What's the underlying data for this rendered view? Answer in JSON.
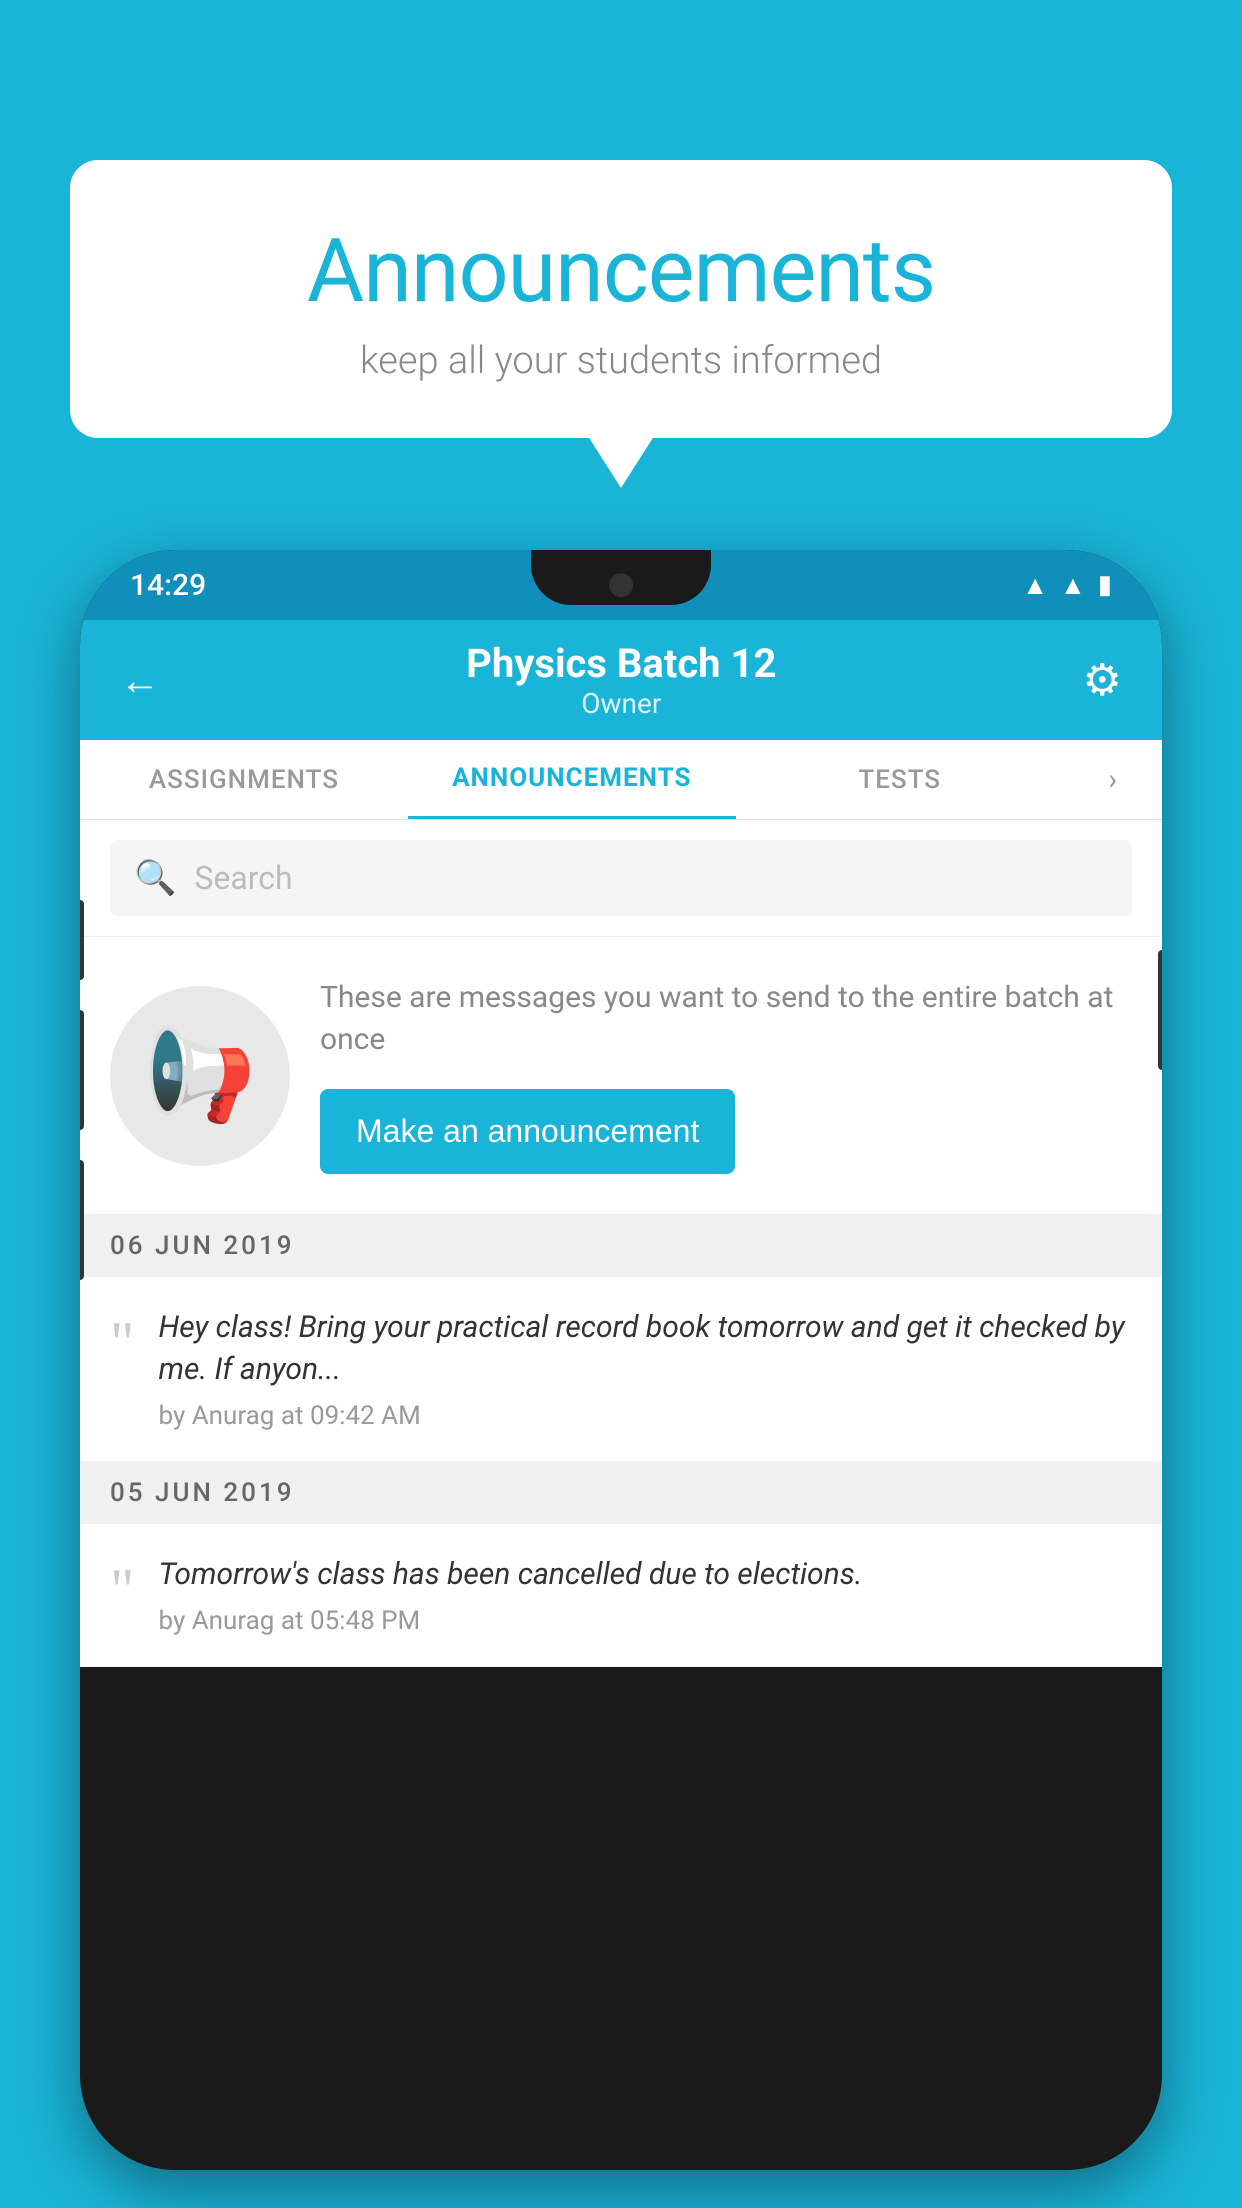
{
  "bubble": {
    "title": "Announcements",
    "subtitle": "keep all your students informed"
  },
  "status_bar": {
    "time": "14:29",
    "wifi": "▲",
    "signal": "▲",
    "battery": "▮"
  },
  "header": {
    "back_label": "←",
    "title": "Physics Batch 12",
    "subtitle": "Owner",
    "settings_label": "⚙"
  },
  "tabs": [
    {
      "label": "ASSIGNMENTS",
      "active": false
    },
    {
      "label": "ANNOUNCEMENTS",
      "active": true
    },
    {
      "label": "TESTS",
      "active": false
    }
  ],
  "search": {
    "placeholder": "Search"
  },
  "promo": {
    "description": "These are messages you want to send to the entire batch at once",
    "button_label": "Make an announcement"
  },
  "announcements": [
    {
      "date": "06  JUN  2019",
      "text": "Hey class! Bring your practical record book tomorrow and get it checked by me. If anyon...",
      "meta": "by Anurag at 09:42 AM"
    },
    {
      "date": "05  JUN  2019",
      "text": "Tomorrow's class has been cancelled due to elections.",
      "meta": "by Anurag at 05:48 PM"
    }
  ],
  "colors": {
    "accent": "#1ab4d8",
    "header_bg": "#1ab4d8",
    "tab_active": "#1ab4d8",
    "button_bg": "#1ab4d8"
  }
}
